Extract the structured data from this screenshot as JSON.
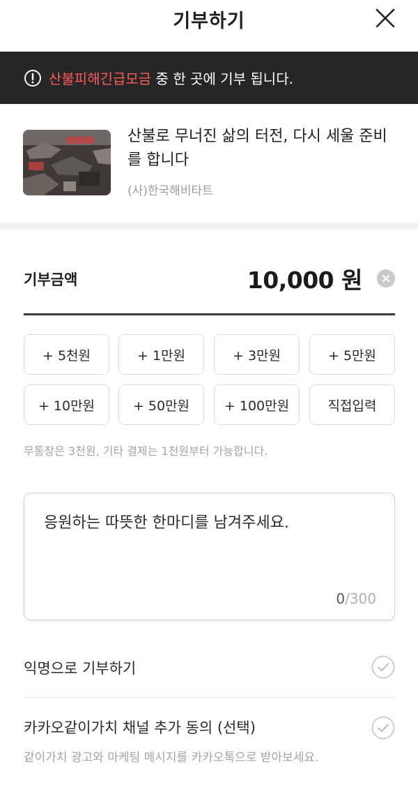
{
  "header": {
    "title": "기부하기",
    "close_icon": "close-icon"
  },
  "notice": {
    "highlight": "산불피해긴급모금",
    "text": " 중 한 곳에 기부 됩니다.",
    "icon": "alert-circle-icon",
    "highlight_color": "#ff5a5a"
  },
  "campaign": {
    "title": "산불로 무너진 삶의 터전, 다시 세울 준비를 합니다",
    "org": "(사)한국해비타트"
  },
  "amount": {
    "label": "기부금액",
    "value": "10,000 원",
    "clear_icon": "clear-icon"
  },
  "chips": [
    "+ 5천원",
    "+ 1만원",
    "+ 3만원",
    "+ 5만원",
    "+ 10만원",
    "+ 50만원",
    "+ 100만원",
    "직접입력"
  ],
  "payment_note": "무통장은 3천원, 기타 결제는 1천원부터 가능합니다.",
  "message": {
    "placeholder": "응원하는 따뜻한 한마디를 남겨주세요.",
    "count": "0",
    "max": "/300"
  },
  "options": {
    "anonymous": {
      "label": "익명으로 기부하기"
    },
    "channel": {
      "label": "카카오같이가치 채널 추가 동의 (선택)",
      "sub": "같이가치 광고와 마케팅 메시지를 카카오톡으로 받아보세요."
    }
  }
}
